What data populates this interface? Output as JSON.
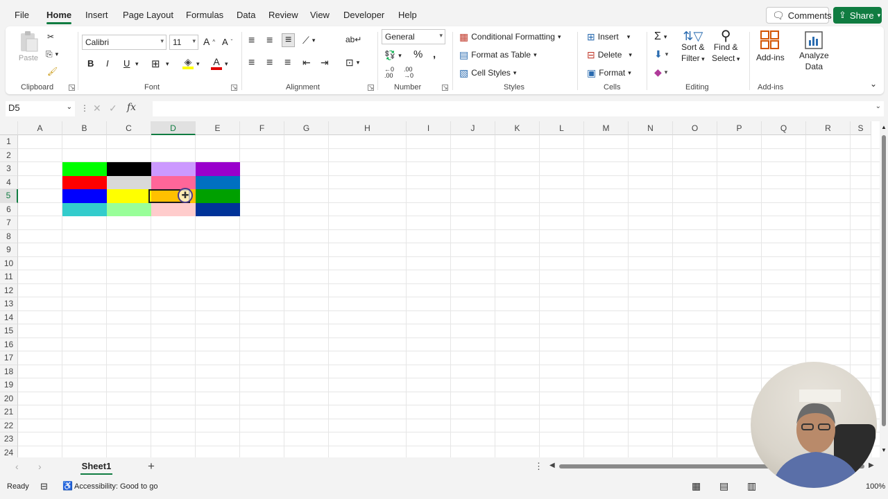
{
  "menu": {
    "tabs": [
      "File",
      "Home",
      "Insert",
      "Page Layout",
      "Formulas",
      "Data",
      "Review",
      "View",
      "Developer",
      "Help"
    ],
    "active": "Home",
    "comments_label": "Comments",
    "share_label": "Share"
  },
  "ribbon": {
    "clipboard": {
      "paste_label": "Paste",
      "group_label": "Clipboard"
    },
    "font": {
      "family": "Calibri",
      "size": "11",
      "bold": "B",
      "italic": "I",
      "underline": "U",
      "group_label": "Font"
    },
    "alignment": {
      "group_label": "Alignment"
    },
    "number": {
      "format": "General",
      "group_label": "Number"
    },
    "styles": {
      "conditional_formatting": "Conditional Formatting",
      "format_as_table": "Format as Table",
      "cell_styles": "Cell Styles",
      "group_label": "Styles"
    },
    "cells": {
      "insert": "Insert",
      "delete": "Delete",
      "format": "Format",
      "group_label": "Cells"
    },
    "editing": {
      "sort_filter_1": "Sort &",
      "sort_filter_2": "Filter",
      "find_select_1": "Find &",
      "find_select_2": "Select",
      "group_label": "Editing"
    },
    "addins": {
      "addins_label": "Add-ins",
      "analyze_1": "Analyze",
      "analyze_2": "Data",
      "group_label": "Add-ins"
    }
  },
  "formula_bar": {
    "name_box": "D5",
    "formula": ""
  },
  "grid": {
    "columns": [
      "A",
      "B",
      "C",
      "D",
      "E",
      "F",
      "G",
      "H",
      "I",
      "J",
      "K",
      "L",
      "M",
      "N",
      "O",
      "P",
      "Q",
      "R",
      "S"
    ],
    "rows": [
      "1",
      "2",
      "3",
      "4",
      "5",
      "6",
      "7",
      "8",
      "9",
      "10",
      "11",
      "12",
      "13",
      "14",
      "15",
      "16",
      "17",
      "18",
      "19",
      "20",
      "21",
      "22",
      "23",
      "24"
    ],
    "selected_column": "D",
    "selected_row": "5",
    "filled_cells": [
      {
        "ref": "B3",
        "color": "#00ff00"
      },
      {
        "ref": "C3",
        "color": "#000000"
      },
      {
        "ref": "D3",
        "color": "#cc99ff"
      },
      {
        "ref": "E3",
        "color": "#9900cc"
      },
      {
        "ref": "B4",
        "color": "#ff0000"
      },
      {
        "ref": "C4",
        "color": "#d9d9d9"
      },
      {
        "ref": "D4",
        "color": "#ff6699"
      },
      {
        "ref": "E4",
        "color": "#0070c0"
      },
      {
        "ref": "B5",
        "color": "#0000ff"
      },
      {
        "ref": "C5",
        "color": "#ffff00"
      },
      {
        "ref": "D5",
        "color": "#ffc000"
      },
      {
        "ref": "E5",
        "color": "#00a000"
      },
      {
        "ref": "B6",
        "color": "#33cccc"
      },
      {
        "ref": "C6",
        "color": "#99ff99"
      },
      {
        "ref": "D6",
        "color": "#ffcccc"
      },
      {
        "ref": "E6",
        "color": "#003399"
      }
    ]
  },
  "sheets": {
    "active": "Sheet1"
  },
  "status": {
    "ready": "Ready",
    "accessibility": "Accessibility: Good to go",
    "zoom": "100%"
  },
  "colors": {
    "accent": "#107c41"
  }
}
